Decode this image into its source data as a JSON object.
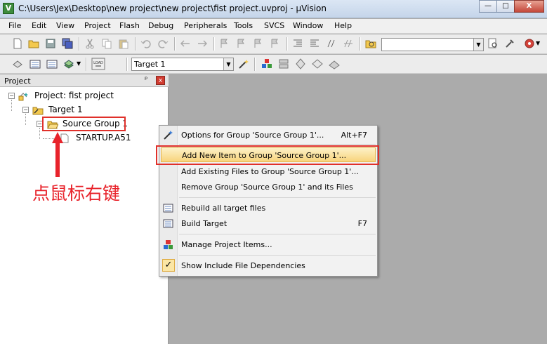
{
  "window": {
    "title": "C:\\Users\\Jex\\Desktop\\new project\\new project\\fist project.uvproj - µVision",
    "app_icon": "V",
    "buttons": {
      "minimize": "—",
      "maximize": "□",
      "close": "X"
    }
  },
  "menubar": {
    "items": [
      "File",
      "Edit",
      "View",
      "Project",
      "Flash",
      "Debug",
      "Peripherals",
      "Tools",
      "SVCS",
      "Window",
      "Help"
    ]
  },
  "toolbar": {
    "target_select": "Target 1",
    "search_value": "",
    "load_label": "LOAD"
  },
  "project_panel": {
    "title": "Project",
    "pin": "ᵖ",
    "close": "x",
    "tree": {
      "project": "Project: fist project",
      "target": "Target 1",
      "group": "Source Group 1",
      "file": "STARTUP.A51"
    }
  },
  "annotation": {
    "text": "点鼠标右键",
    "color": "#e8232b"
  },
  "context_menu": {
    "items": [
      {
        "label": "Options for Group 'Source Group 1'...",
        "shortcut": "Alt+F7",
        "icon": "options-wand-icon"
      },
      {
        "label": "Add New  Item to Group 'Source Group 1'...",
        "shortcut": "",
        "icon": "",
        "highlighted": true
      },
      {
        "label": "Add Existing Files to Group 'Source Group 1'...",
        "shortcut": "",
        "icon": ""
      },
      {
        "label": "Remove Group 'Source Group 1' and its Files",
        "shortcut": "",
        "icon": ""
      },
      {
        "label": "Rebuild all target files",
        "shortcut": "",
        "icon": "rebuild-icon"
      },
      {
        "label": "Build Target",
        "shortcut": "F7",
        "icon": "build-icon"
      },
      {
        "label": "Manage Project Items...",
        "shortcut": "",
        "icon": "manage-items-icon"
      },
      {
        "label": "Show Include File Dependencies",
        "shortcut": "",
        "icon": "checkmark-icon",
        "checked": true
      }
    ],
    "check_glyph": "✓"
  },
  "colors": {
    "highlight_border": "#e0302a",
    "workspace": "#ababab"
  }
}
